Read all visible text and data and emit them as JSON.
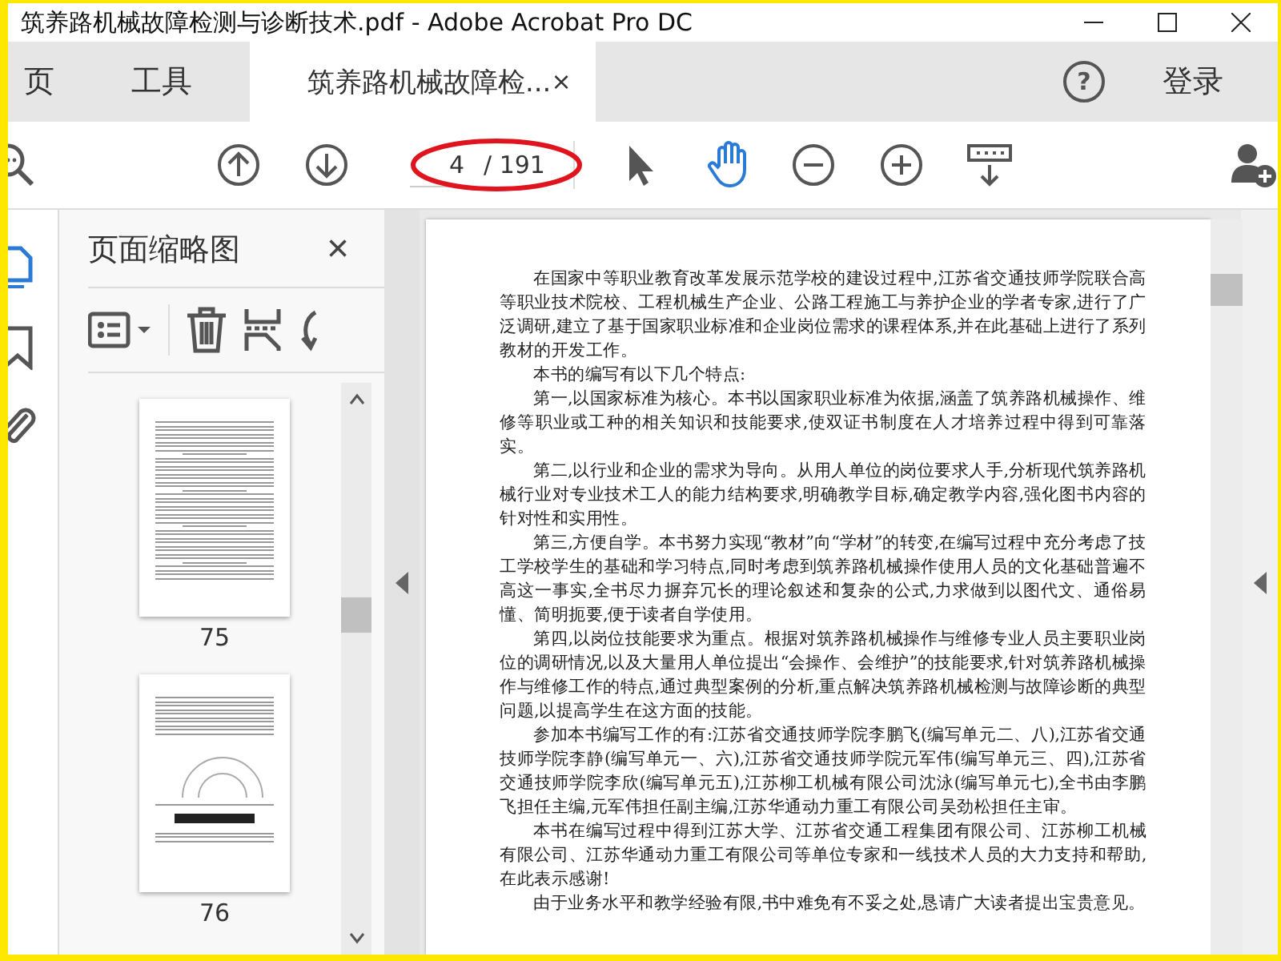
{
  "window": {
    "title": "筑养路机械故障检测与诊断技术.pdf - Adobe Acrobat Pro DC"
  },
  "tabs": [
    {
      "label": "页",
      "selected": false
    },
    {
      "label": "工具",
      "selected": false
    },
    {
      "label": "筑养路机械故障检...",
      "selected": true,
      "close": "×"
    }
  ],
  "help": "?",
  "sign_in": "登录",
  "toolbar": {
    "page": {
      "current": "4",
      "total": "/ 191"
    },
    "tools": [
      {
        "kind": "select",
        "selected": false
      },
      {
        "kind": "hand",
        "selected": true
      }
    ]
  },
  "rail": [
    {
      "kind": "pages",
      "selected": true
    },
    {
      "kind": "bookmarks",
      "selected": false
    },
    {
      "kind": "attachments",
      "selected": false
    }
  ],
  "panel": {
    "title": "页面缩略图",
    "close": "×",
    "thumbnails": [
      {
        "label": "75",
        "kind": "text"
      },
      {
        "label": "76",
        "kind": "figure"
      }
    ]
  },
  "document": {
    "paragraphs": [
      "在国家中等职业教育改革发展示范学校的建设过程中,江苏省交通技师学院联合高等职业技术院校、工程机械生产企业、公路工程施工与养护企业的学者专家,进行了广泛调研,建立了基于国家职业标准和企业岗位需求的课程体系,并在此基础上进行了系列教材的开发工作。",
      "本书的编写有以下几个特点:",
      "第一,以国家标准为核心。本书以国家职业标准为依据,涵盖了筑养路机械操作、维修等职业或工种的相关知识和技能要求,使双证书制度在人才培养过程中得到可靠落实。",
      "第二,以行业和企业的需求为导向。从用人单位的岗位要求人手,分析现代筑养路机械行业对专业技术工人的能力结构要求,明确教学目标,确定教学内容,强化图书内容的针对性和实用性。",
      "第三,方便自学。本书努力实现“教材”向“学材”的转变,在编写过程中充分考虑了技工学校学生的基础和学习特点,同时考虑到筑养路机械操作使用人员的文化基础普遍不高这一事实,全书尽力摒弃冗长的理论叙述和复杂的公式,力求做到以图代文、通俗易懂、简明扼要,便于读者自学使用。",
      "第四,以岗位技能要求为重点。根据对筑养路机械操作与维修专业人员主要职业岗位的调研情况,以及大量用人单位提出“会操作、会维护”的技能要求,针对筑养路机械操作与维修工作的特点,通过典型案例的分析,重点解决筑养路机械检测与故障诊断的典型问题,以提高学生在这方面的技能。",
      "参加本书编写工作的有:江苏省交通技师学院李鹏飞(编写单元二、八),江苏省交通技师学院李静(编写单元一、六),江苏省交通技师学院元军伟(编写单元三、四),江苏省交通技师学院李欣(编写单元五),江苏柳工机械有限公司沈泳(编写单元七),全书由李鹏飞担任主编,元军伟担任副主编,江苏华通动力重工有限公司吴劲松担任主审。",
      "本书在编写过程中得到江苏大学、江苏省交通工程集团有限公司、江苏柳工机械有限公司、江苏华通动力重工有限公司等单位专家和一线技术人员的大力支持和帮助,在此表示感谢!",
      "由于业务水平和教学经验有限,书中难免有不妥之处,恳请广大读者提出宝贵意见。"
    ]
  }
}
